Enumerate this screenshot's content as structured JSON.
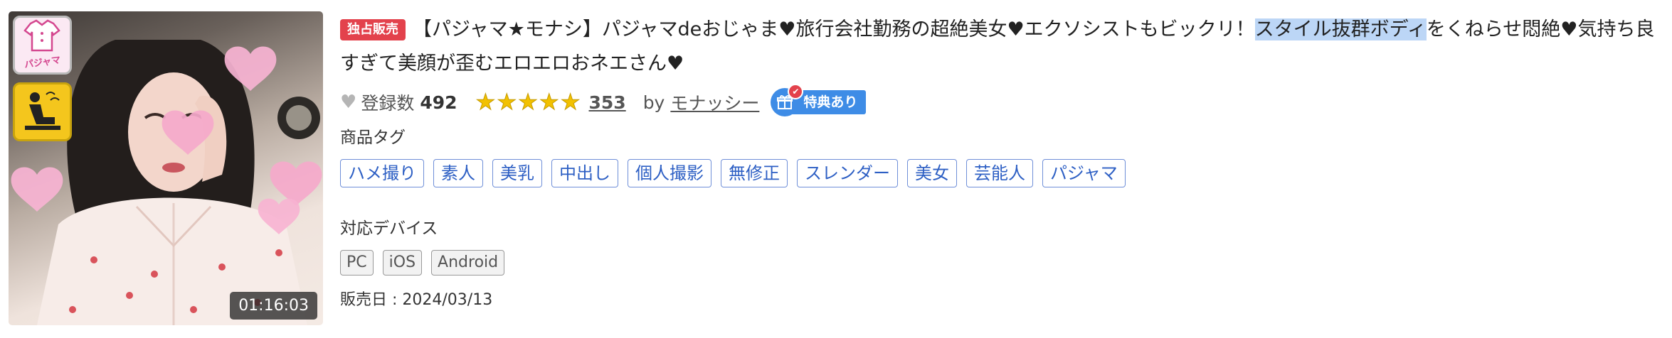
{
  "thumbnail": {
    "duration": "01:16:03",
    "badges": [
      {
        "name": "pajama-badge",
        "label": "パジャマ"
      },
      {
        "name": "pose-badge",
        "label": ""
      }
    ]
  },
  "product": {
    "exclusive_label": "独占販売",
    "title_before": "【パジャマ★モナシ】パジャマdeおじゃま♥旅行会社勤務の超絶美女♥エクソシストもビックリ！",
    "title_highlight": "スタイル抜群ボディ",
    "title_after": "をくねらせ悶絶♥気持ち良すぎて美顔が歪むエロエロおネエさん♥",
    "registered_label": "登録数",
    "registered_count": "492",
    "rating": 5,
    "review_count": "353",
    "by_label": "by",
    "author": "モナッシー",
    "bonus_label": "特典あり"
  },
  "tags_section": {
    "label": "商品タグ",
    "tags": [
      "ハメ撮り",
      "素人",
      "美乳",
      "中出し",
      "個人撮影",
      "無修正",
      "スレンダー",
      "美女",
      "芸能人",
      "パジャマ"
    ]
  },
  "devices_section": {
    "label": "対応デバイス",
    "devices": [
      "PC",
      "iOS",
      "Android"
    ]
  },
  "release": {
    "text": "販売日 : 2024/03/13"
  },
  "colors": {
    "exclusive_bg": "#e3424c",
    "tag_text": "#2d5fc4",
    "bonus_bg": "#3e8ce6",
    "star": "#f2c100",
    "highlight": "#bcd6f6"
  }
}
